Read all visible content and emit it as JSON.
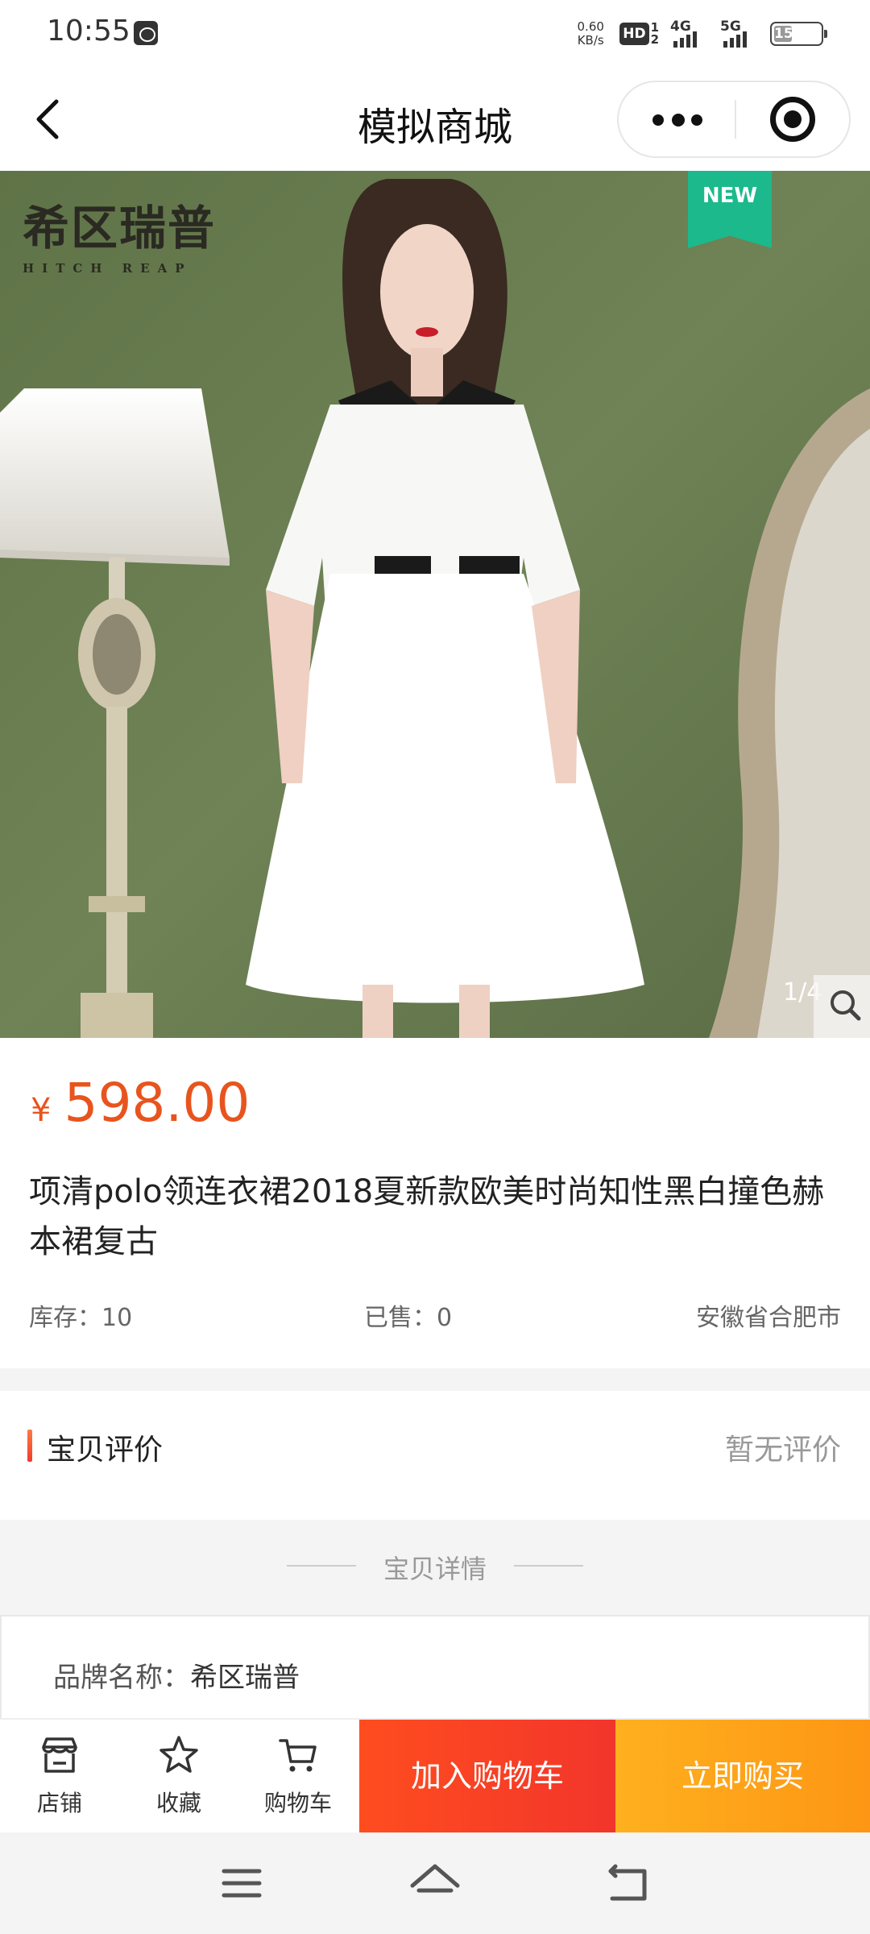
{
  "status_bar": {
    "time": "10:55",
    "net_speed_value": "0.60",
    "net_speed_unit": "KB/s",
    "hd_label": "HD",
    "sim1": "1",
    "sim2": "2",
    "signal1": "4G",
    "signal2": "5G",
    "battery": "15",
    "battery_level": 0.15
  },
  "nav": {
    "title": "模拟商城",
    "back_icon": "chevron-left-icon",
    "more_icon": "more-dots-icon",
    "close_icon": "target-icon"
  },
  "gallery": {
    "brand_cn": "希区瑞普",
    "brand_en": "HITCH REAP",
    "badge": "NEW",
    "counter": "1/4",
    "zoom_icon": "search-icon"
  },
  "product": {
    "currency": "¥",
    "price": "598.00",
    "title": "项清polo领连衣裙2018夏新款欧美时尚知性黑白撞色赫本裙复古",
    "stock": "库存：10",
    "sold": "已售：0",
    "location": "安徽省合肥市"
  },
  "reviews": {
    "title": "宝贝评价",
    "empty_text": "暂无评价"
  },
  "details": {
    "heading": "宝贝详情",
    "brand_label": "品牌名称：",
    "brand_value": "希区瑞普"
  },
  "actions": {
    "store": "店铺",
    "favorite": "收藏",
    "cart": "购物车",
    "add_to_cart": "加入购物车",
    "buy_now": "立即购买"
  },
  "colors": {
    "price": "#e8541e",
    "add_to_cart": "#f2352b",
    "buy_now": "#fd9614",
    "badge": "#1cb98c"
  }
}
